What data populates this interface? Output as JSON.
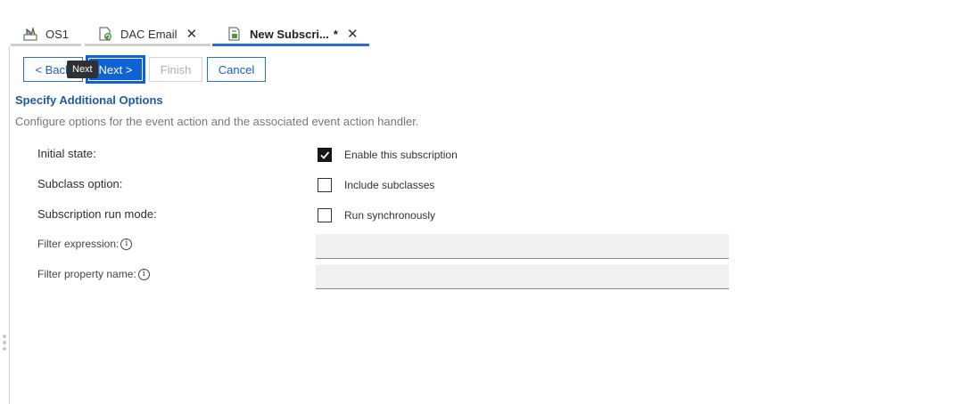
{
  "tabs": [
    {
      "label": "OS1",
      "icon": "object-store-icon",
      "closable": false,
      "active": false
    },
    {
      "label": "DAC Email",
      "icon": "document-refresh-icon",
      "closable": true,
      "active": false
    },
    {
      "label": "New Subscri...",
      "dirty_marker": "*",
      "icon": "subscription-icon",
      "closable": true,
      "active": true
    }
  ],
  "close_glyph": "✕",
  "wizard": {
    "back_label": "< Back",
    "next_label": "Next >",
    "finish_label": "Finish",
    "cancel_label": "Cancel",
    "tooltip": "Next"
  },
  "section": {
    "title": "Specify Additional Options",
    "description": "Configure options for the event action and the associated event action handler."
  },
  "options": {
    "initial_state": {
      "label": "Initial state:",
      "checkbox_label": "Enable this subscription",
      "checked": true
    },
    "subclass": {
      "label": "Subclass option:",
      "checkbox_label": "Include subclasses",
      "checked": false
    },
    "run_mode": {
      "label": "Subscription run mode:",
      "checkbox_label": "Run synchronously",
      "checked": false
    }
  },
  "fields": {
    "filter_expression": {
      "label": "Filter expression:",
      "value": ""
    },
    "filter_property": {
      "label": "Filter property name:",
      "value": ""
    }
  },
  "info_glyph": "i",
  "colors": {
    "accent": "#0f62d5",
    "title": "#1f5aa6",
    "field_bg": "#f0f0f0"
  }
}
